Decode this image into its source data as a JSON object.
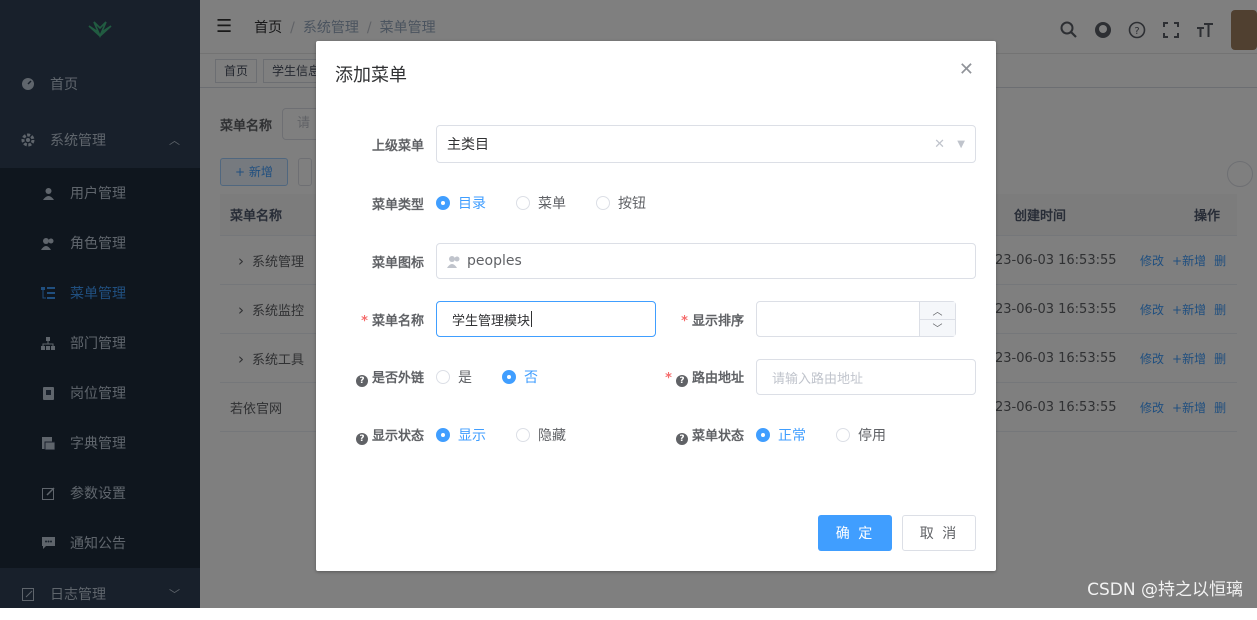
{
  "sidebar": {
    "items": [
      {
        "label": "首页",
        "icon": "dashboard-icon"
      },
      {
        "label": "系统管理",
        "icon": "gear-icon"
      }
    ],
    "subitems": [
      {
        "label": "用户管理",
        "icon": "user-icon"
      },
      {
        "label": "角色管理",
        "icon": "peoples-icon"
      },
      {
        "label": "菜单管理",
        "icon": "tree-table-icon"
      },
      {
        "label": "部门管理",
        "icon": "tree-icon"
      },
      {
        "label": "岗位管理",
        "icon": "post-icon"
      },
      {
        "label": "字典管理",
        "icon": "dict-icon"
      },
      {
        "label": "参数设置",
        "icon": "edit-icon"
      },
      {
        "label": "通知公告",
        "icon": "message-icon"
      }
    ],
    "bottom_item": {
      "label": "日志管理",
      "icon": "log-icon"
    }
  },
  "navbar": {
    "breadcrumb": [
      "首页",
      "系统管理",
      "菜单管理"
    ]
  },
  "tags": [
    "首页",
    "学生信息"
  ],
  "filter": {
    "label": "菜单名称",
    "placeholder": "请"
  },
  "toolbar": {
    "add_label": "+ 新增"
  },
  "table": {
    "headers": {
      "name": "菜单名称",
      "created": "创建时间",
      "ops": "操作"
    },
    "rows": [
      {
        "name": "系统管理",
        "expandable": true,
        "created": "23-06-03 16:53:55"
      },
      {
        "name": "系统监控",
        "expandable": true,
        "created": "23-06-03 16:53:55"
      },
      {
        "name": "系统工具",
        "expandable": true,
        "created": "23-06-03 16:53:55"
      },
      {
        "name": "若依官网",
        "expandable": false,
        "created": "23-06-03 16:53:55"
      }
    ],
    "ops": {
      "edit": "修改",
      "add": "+新增",
      "del": "删"
    }
  },
  "dialog": {
    "title": "添加菜单",
    "fields": {
      "parent_menu": {
        "label": "上级菜单",
        "value": "主类目"
      },
      "menu_type": {
        "label": "菜单类型",
        "options": [
          "目录",
          "菜单",
          "按钮"
        ],
        "selected": "目录"
      },
      "menu_icon": {
        "label": "菜单图标",
        "value": "peoples"
      },
      "menu_name": {
        "label": "菜单名称",
        "value": "学生管理模块"
      },
      "sort": {
        "label": "显示排序",
        "value": ""
      },
      "is_frame": {
        "label": "是否外链",
        "options": [
          "是",
          "否"
        ],
        "selected": "否"
      },
      "route": {
        "label": "路由地址",
        "placeholder": "请输入路由地址"
      },
      "visible": {
        "label": "显示状态",
        "options": [
          "显示",
          "隐藏"
        ],
        "selected": "显示"
      },
      "status": {
        "label": "菜单状态",
        "options": [
          "正常",
          "停用"
        ],
        "selected": "正常"
      }
    },
    "confirm_label": "确 定",
    "cancel_label": "取 消"
  },
  "watermark": "CSDN @持之以恒璃",
  "colors": {
    "primary": "#409eff",
    "sidebar": "#304156",
    "required": "#f56c6c"
  }
}
